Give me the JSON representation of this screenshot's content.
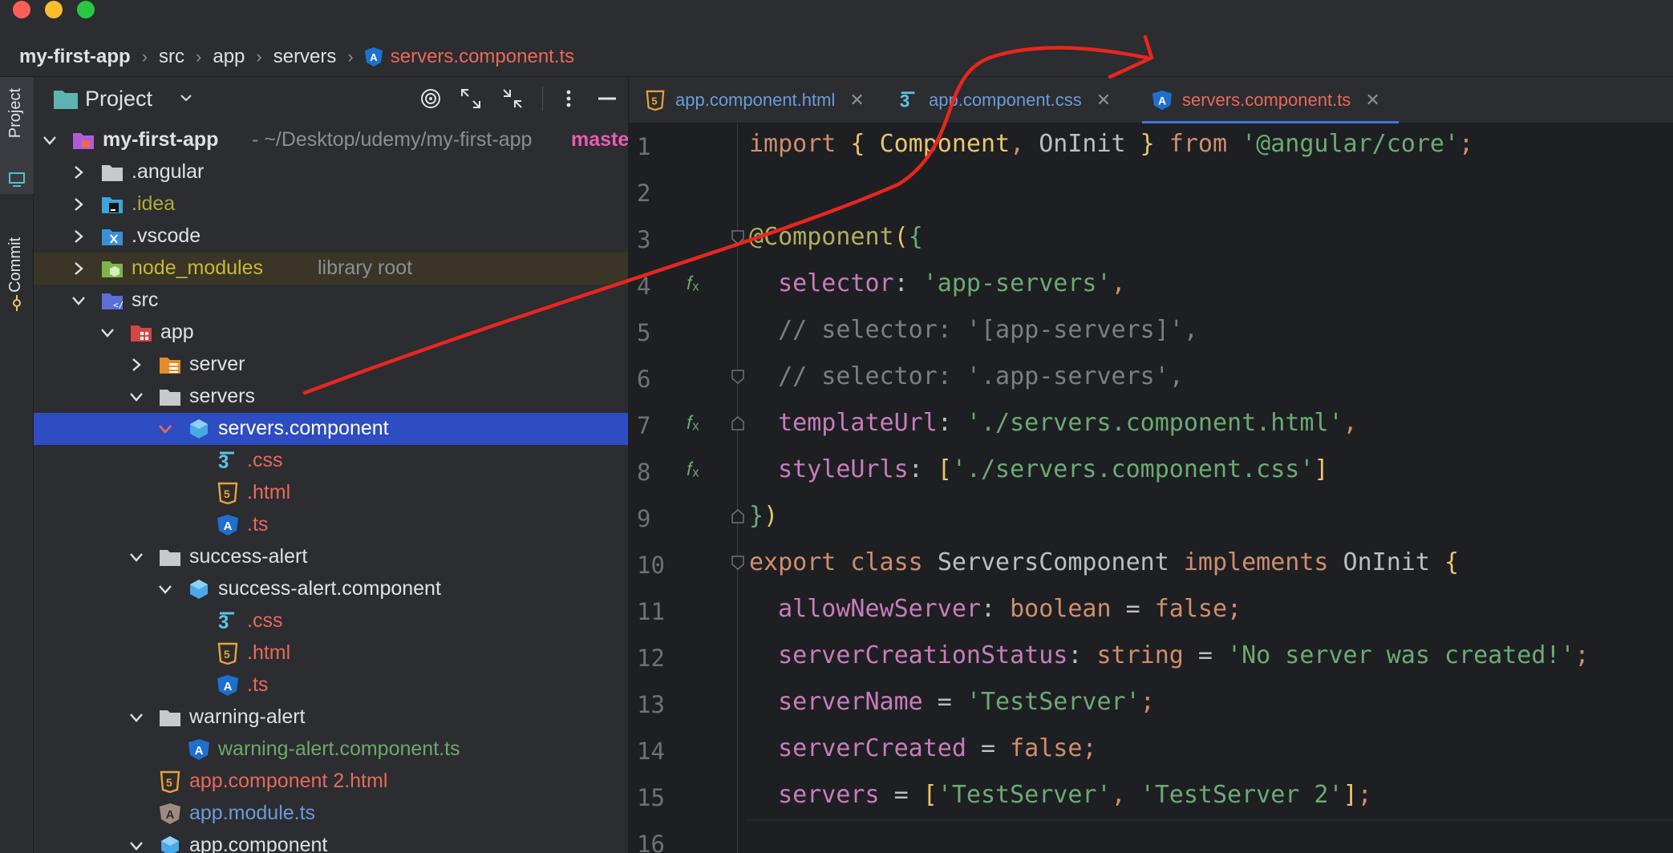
{
  "window": {
    "breadcrumb": [
      "my-first-app",
      "src",
      "app",
      "servers",
      "servers.component.ts"
    ]
  },
  "sidebar_strip": {
    "project_label": "Project",
    "commit_label": "Commit"
  },
  "project_panel": {
    "title": "Project",
    "tree": [
      {
        "label": "my-first-app",
        "path": "- ~/Desktop/udemy/my-first-app",
        "branch": "maste"
      },
      {
        "label": ".angular"
      },
      {
        "label": ".idea"
      },
      {
        "label": ".vscode"
      },
      {
        "label": "node_modules",
        "note": "library root"
      },
      {
        "label": "src"
      },
      {
        "label": "app"
      },
      {
        "label": "server"
      },
      {
        "label": "servers"
      },
      {
        "label": "servers.component"
      },
      {
        "label": ".css"
      },
      {
        "label": ".html"
      },
      {
        "label": ".ts"
      },
      {
        "label": "success-alert"
      },
      {
        "label": "success-alert.component"
      },
      {
        "label": ".css"
      },
      {
        "label": ".html"
      },
      {
        "label": ".ts"
      },
      {
        "label": "warning-alert"
      },
      {
        "label": "warning-alert.component.ts"
      },
      {
        "label": "app.component 2.html"
      },
      {
        "label": "app.module.ts"
      },
      {
        "label": "app.component"
      }
    ]
  },
  "tabs": [
    {
      "label": "app.component.html"
    },
    {
      "label": "app.component.css"
    },
    {
      "label": "servers.component.ts"
    }
  ],
  "code": {
    "line_numbers": [
      "1",
      "2",
      "3",
      "4",
      "5",
      "6",
      "7",
      "8",
      "9",
      "10",
      "11",
      "12",
      "13",
      "14",
      "15",
      "16"
    ],
    "lines": [
      {
        "t1": "import",
        "t2": " { ",
        "t3": "Component",
        "t4": ", ",
        "t5": "OnInit",
        "t6": " } ",
        "t7": "from",
        "t8": " '@angular/core'",
        "t9": ";"
      },
      {},
      {
        "t1": "@Component",
        "t2": "(",
        "t3": "{"
      },
      {
        "t1": "  selector",
        "t2": ": ",
        "t3": "'app-servers'",
        "t4": ","
      },
      {
        "t1": "  // selector: '[app-servers]',"
      },
      {
        "t1": "  // selector: '.app-servers',"
      },
      {
        "t1": "  templateUrl",
        "t2": ": ",
        "t3": "'./servers.component.html'",
        "t4": ","
      },
      {
        "t1": "  styleUrls",
        "t2": ": ",
        "t3": "[",
        "t4": "'./servers.component.css'",
        "t5": "]"
      },
      {
        "t1": "}",
        "t2": ")"
      },
      {
        "t1": "export class ",
        "t2": "ServersComponent ",
        "t3": "implements ",
        "t4": "OnInit ",
        "t5": "{"
      },
      {
        "t1": "  allowNewServer",
        "t2": ": ",
        "t3": "boolean",
        "t4": " = ",
        "t5": "false",
        "t6": ";"
      },
      {
        "t1": "  serverCreationStatus",
        "t2": ": ",
        "t3": "string",
        "t4": " = ",
        "t5": "'No server was created!'",
        "t6": ";"
      },
      {
        "t1": "  serverName",
        "t2": " = ",
        "t3": "'TestServer'",
        "t4": ";"
      },
      {
        "t1": "  serverCreated",
        "t2": " = ",
        "t3": "false",
        "t4": ";"
      },
      {
        "t1": "  servers",
        "t2": " = ",
        "t3": "[",
        "t4": "'TestServer'",
        "t5": ", ",
        "t6": "'TestServer 2'",
        "t7": "]",
        "t8": ";"
      },
      {}
    ]
  },
  "colors": {
    "accent_selection": "#2e4dc2",
    "annotation_stroke": "#e8261f"
  }
}
